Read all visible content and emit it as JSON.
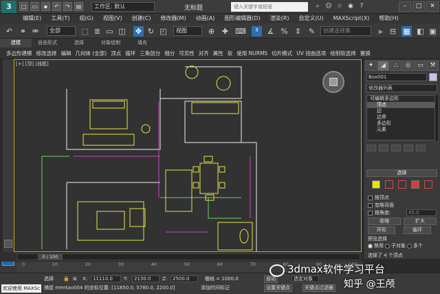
{
  "titlebar": {
    "workspace_label": "工作区: 默认",
    "window_title": "无标题",
    "search_placeholder": "键入关键字或短语"
  },
  "menus": [
    "编辑(E)",
    "工具(T)",
    "组(G)",
    "视图(V)",
    "创建(C)",
    "修改器(M)",
    "动画(A)",
    "图形编辑器(D)",
    "渲染(R)",
    "自定义(U)",
    "MAXScript(X)",
    "帮助(H)"
  ],
  "toolbar": {
    "filter_select": "全部",
    "view_select": "视图",
    "named_selection": "创建选择集"
  },
  "ribbon": {
    "tabs": [
      "建模",
      "自由形式",
      "选择",
      "对象绘制",
      "填充"
    ],
    "tools": [
      "多边形建模",
      "修改选择",
      "编辑",
      "几何体 (全部)",
      "顶点",
      "循环",
      "三角剖分",
      "细分",
      "可见性",
      "对齐",
      "属性",
      "软",
      "使用 NURMS",
      "切片模式",
      "UV 扭曲选项",
      "绘制软选择",
      "置换"
    ]
  },
  "viewport": {
    "label": "[+] [顶] [线框]"
  },
  "command_panel": {
    "object_name": "Box001",
    "modifier_list": "修改器列表",
    "stack": {
      "root": "可编辑多边形",
      "items": [
        "顶点",
        "边",
        "边界",
        "多边形",
        "元素"
      ],
      "selected": "顶点"
    },
    "selection_rollout": "选择",
    "by_vertex": "按顶点",
    "ignore_backface": "忽略背面",
    "by_angle": "按角度:",
    "angle_value": "45.0",
    "shrink": "收缩",
    "grow": "扩大",
    "ring": "环形",
    "loop": "循环",
    "preview_selection": "预览选择",
    "preview_options": [
      "禁用",
      "子对象",
      "多个"
    ],
    "status": "选择了 4 个顶点"
  },
  "timeline": {
    "frame": "0 / 100",
    "ruler": [
      "0",
      "10",
      "20",
      "30",
      "40",
      "50",
      "60",
      "70",
      "80",
      "90",
      "100"
    ]
  },
  "statusbar": {
    "selection_label": "选择",
    "x_label": "X:",
    "x_value": "11110.0",
    "y_label": "Y:",
    "y_value": "2130.0",
    "z_label": "Z:",
    "z_value": "2500.0",
    "grid": "栅格 = 1000.0",
    "prompt": "单击并拖动以选择并移动对象",
    "snap_info": "捕捉 mentao004 的坐标位置: [11850.0, 5780.0, 2200.0]",
    "add_time_tag": "添加时间标记",
    "auto_key": "自动",
    "selected_object": "选定对象",
    "set_key": "设置关键点",
    "key_filters": "关键点过滤器",
    "welcome": "欢迎使用 MAXSc"
  },
  "watermark": {
    "line1": "3dmax软件学习平台",
    "line2": "知乎 @王颅"
  },
  "colors": {
    "accent": "#2f6fb0",
    "floorplan_yellow": "#e6e64a",
    "floorplan_white": "#f0f0f0",
    "floorplan_magenta": "#c04ac0",
    "floorplan_green": "#6ad06a"
  }
}
